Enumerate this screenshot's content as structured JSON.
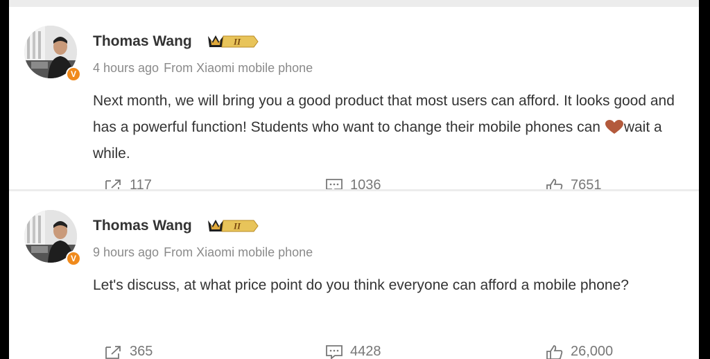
{
  "posts": [
    {
      "author": "Thomas Wang",
      "level_badge": "II",
      "verified_mark": "V",
      "time": "4 hours ago",
      "source": "From Xiaomi mobile phone",
      "text_before_emoji": "Next month, we will bring you a good product that most users can afford. It looks good and has a powerful function! Students who want to change their mobile phones can ",
      "emoji": "heart-icon",
      "text_after_emoji": "wait a while.",
      "forwards": "117",
      "comments": "1036",
      "likes": "7651"
    },
    {
      "author": "Thomas Wang",
      "level_badge": "II",
      "verified_mark": "V",
      "time": "9 hours ago",
      "source": "From Xiaomi mobile phone",
      "text": "Let's discuss, at what price point do you think everyone can afford a mobile phone?",
      "forwards": "365",
      "comments": "4428",
      "likes": "26,000"
    }
  ],
  "colors": {
    "background": "#ececec",
    "card": "#ffffff",
    "text": "#333333",
    "muted": "#8a8a8a",
    "badge_orange": "#f08a1c",
    "crown_gold": "#d9a62e",
    "heart": "#b35a3c"
  },
  "icons": [
    "forward-icon",
    "comment-icon",
    "like-icon",
    "crown-icon",
    "heart-icon",
    "verified-icon"
  ]
}
